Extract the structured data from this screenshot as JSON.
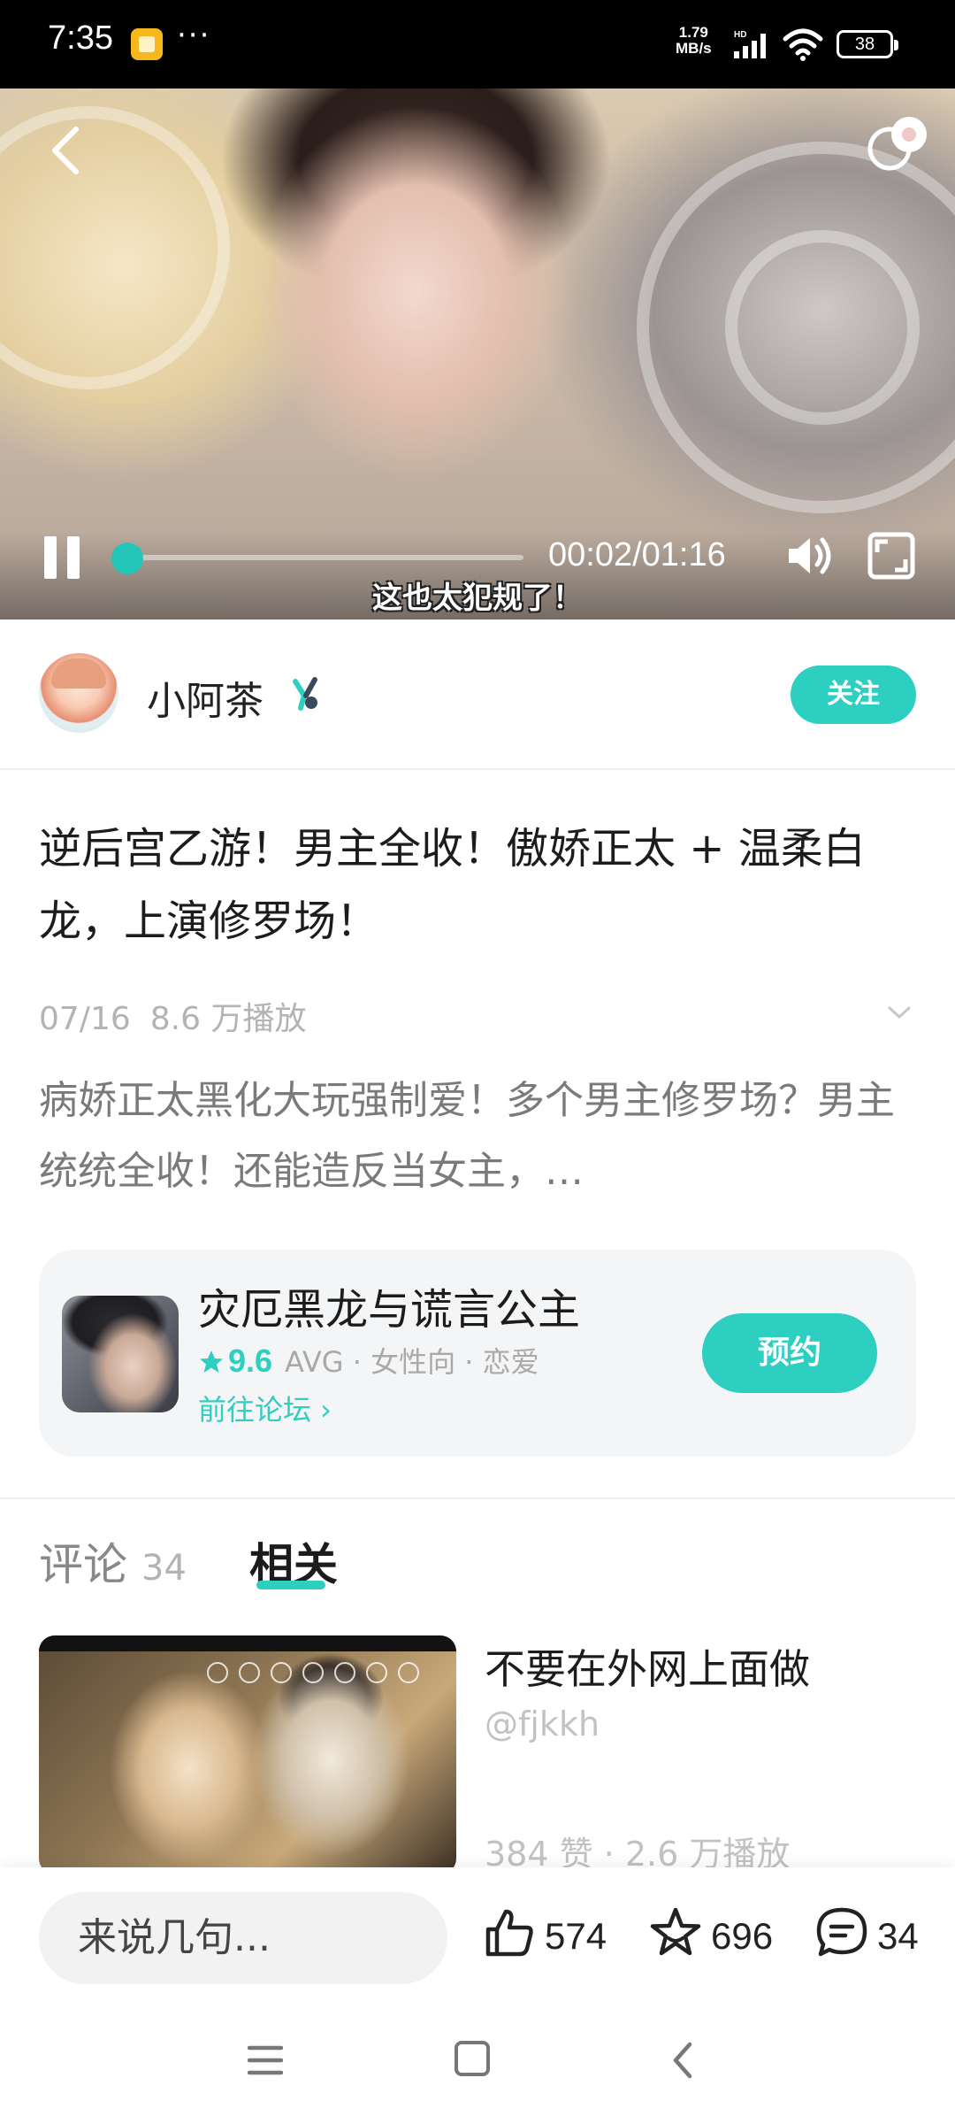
{
  "status_bar": {
    "time": "7:35",
    "more": "···",
    "net_speed_value": "1.79",
    "net_speed_unit": "MB/s",
    "network_type": "HD",
    "battery": "38"
  },
  "video": {
    "current_time": "00:02",
    "duration": "01:16",
    "time_display": "00:02/01:16",
    "progress": 0.026,
    "subtitle": "这也太犯规了！"
  },
  "author": {
    "name": "小阿茶",
    "follow_label": "关注"
  },
  "post": {
    "title": "逆后宫乙游！男主全收！傲娇正太 + 温柔白龙，上演修罗场！",
    "date": "07/16",
    "views": "8.6 万播放",
    "description": "病娇正太黑化大玩强制爱！多个男主修罗场？男主统统全收！还能造反当女主，…"
  },
  "game_card": {
    "name": "灾厄黑龙与谎言公主",
    "rating": "9.6",
    "tags": "AVG · 女性向 · 恋爱",
    "forum_link": "前往论坛 ›",
    "reserve_label": "预约"
  },
  "tabs": {
    "comments_label": "评论",
    "comments_count": "34",
    "related_label": "相关"
  },
  "related": [
    {
      "title": "不要在外网上面做",
      "author": "@fjkkh",
      "stats": "384 赞 · 2.6 万播放"
    }
  ],
  "bottom_bar": {
    "comment_placeholder": "来说几句...",
    "likes": "574",
    "favorites": "696",
    "comments": "34"
  },
  "colors": {
    "accent": "#2ccfc0",
    "text_primary": "#1c1c1c",
    "text_muted": "#b3b3b3"
  }
}
